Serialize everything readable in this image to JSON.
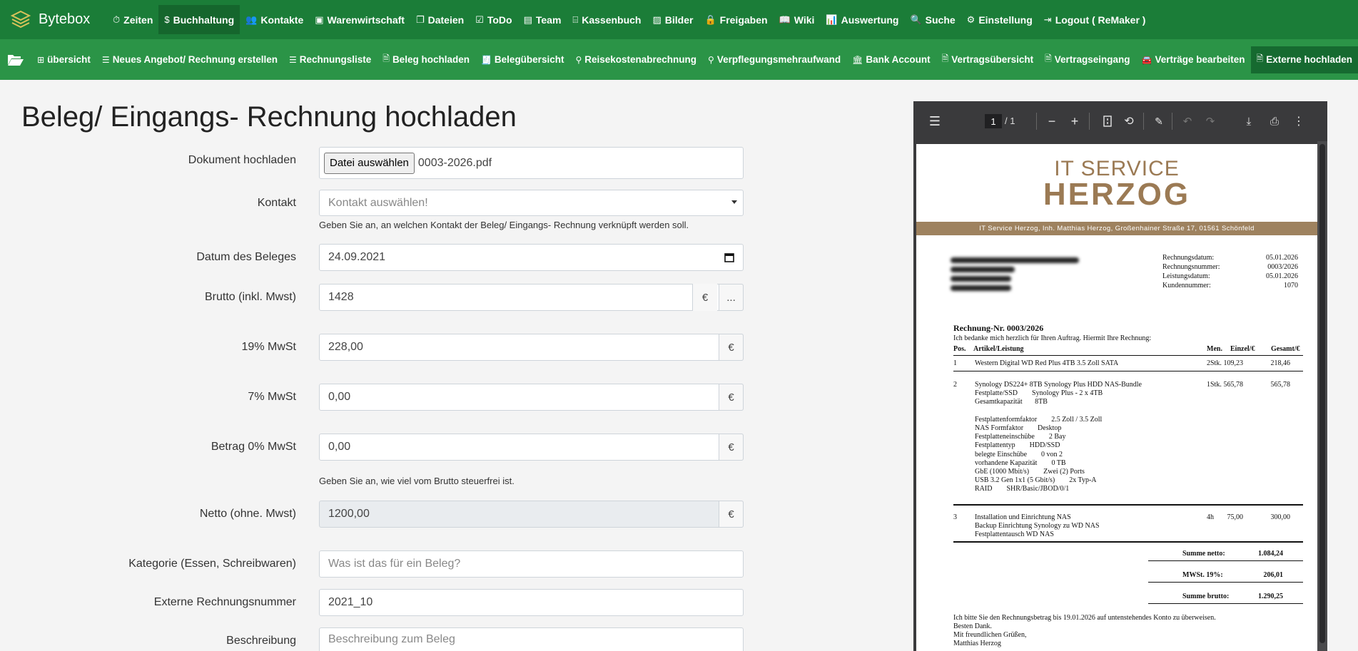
{
  "app": {
    "name": "Bytebox"
  },
  "topnav": [
    {
      "label": "Zeiten",
      "icon": "clock-icon",
      "glyph": "⏱",
      "active": false
    },
    {
      "label": "Buchhaltung",
      "icon": "invoice-icon",
      "glyph": "$",
      "active": true
    },
    {
      "label": "Kontakte",
      "icon": "users-icon",
      "glyph": "👥",
      "active": false
    },
    {
      "label": "Warenwirtschaft",
      "icon": "warehouse-icon",
      "glyph": "▣",
      "active": false
    },
    {
      "label": "Dateien",
      "icon": "files-icon",
      "glyph": "❐",
      "active": false
    },
    {
      "label": "ToDo",
      "icon": "clipboard-icon",
      "glyph": "☑",
      "active": false
    },
    {
      "label": "Team",
      "icon": "id-card-icon",
      "glyph": "▤",
      "active": false
    },
    {
      "label": "Kassenbuch",
      "icon": "cash-register-icon",
      "glyph": "⌸",
      "active": false
    },
    {
      "label": "Bilder",
      "icon": "image-icon",
      "glyph": "▨",
      "active": false
    },
    {
      "label": "Freigaben",
      "icon": "lock-icon",
      "glyph": "🔒",
      "active": false
    },
    {
      "label": "Wiki",
      "icon": "book-icon",
      "glyph": "📖",
      "active": false
    },
    {
      "label": "Auswertung",
      "icon": "chart-icon",
      "glyph": "📊",
      "active": false
    },
    {
      "label": "Suche",
      "icon": "search-icon",
      "glyph": "🔍",
      "active": false
    },
    {
      "label": "Einstellung",
      "icon": "gear-icon",
      "glyph": "⚙",
      "active": false
    },
    {
      "label": "Logout ( ReMaker )",
      "icon": "logout-icon",
      "glyph": "⇥",
      "active": false
    }
  ],
  "subnav": [
    {
      "label": "übersicht",
      "icon": "table-icon",
      "glyph": "⊞",
      "active": false
    },
    {
      "label": "Neues Angebot/ Rechnung erstellen",
      "icon": "list-icon",
      "glyph": "☰",
      "active": false
    },
    {
      "label": "Rechnungsliste",
      "icon": "list-icon",
      "glyph": "☰",
      "active": false
    },
    {
      "label": "Beleg hochladen",
      "icon": "file-upload-icon",
      "glyph": "🗎",
      "active": false
    },
    {
      "label": "Belegübersicht",
      "icon": "receipt-icon",
      "glyph": "🧾",
      "active": false
    },
    {
      "label": "Reisekostenabrechnung",
      "icon": "route-icon",
      "glyph": "⚲",
      "active": false
    },
    {
      "label": "Verpflegungsmehraufwand",
      "icon": "route-icon",
      "glyph": "⚲",
      "active": false
    },
    {
      "label": "Bank Account",
      "icon": "bank-icon",
      "glyph": "🏛",
      "active": false
    },
    {
      "label": "Vertragsübersicht",
      "icon": "document-icon",
      "glyph": "🗎",
      "active": false
    },
    {
      "label": "Vertragseingang",
      "icon": "document-icon",
      "glyph": "🗎",
      "active": false
    },
    {
      "label": "Verträge bearbeiten",
      "icon": "car-icon",
      "glyph": "🚘",
      "active": false
    },
    {
      "label": "Externe hochladen",
      "icon": "document-icon",
      "glyph": "🗎",
      "active": true
    }
  ],
  "page": {
    "title": "Beleg/ Eingangs- Rechnung hochladen"
  },
  "form": {
    "upload": {
      "label": "Dokument hochladen",
      "button": "Datei auswählen",
      "filename": "0003-2026.pdf"
    },
    "contact": {
      "label": "Kontakt",
      "placeholder": "Kontakt auswählen!",
      "hint": "Geben Sie an, an welchen Kontakt der Beleg/ Eingangs- Rechnung verknüpft werden soll."
    },
    "date": {
      "label": "Datum des Beleges",
      "value": "24.09.2021"
    },
    "gross": {
      "label": "Brutto (inkl. Mwst)",
      "value": "1428",
      "currency": "€",
      "more": "..."
    },
    "vat19": {
      "label": "19% MwSt",
      "value": "228,00",
      "currency": "€"
    },
    "vat7": {
      "label": "7% MwSt",
      "value": "0,00",
      "currency": "€"
    },
    "vat0": {
      "label": "Betrag 0% MwSt",
      "value": "0,00",
      "currency": "€",
      "hint": "Geben Sie an, wie viel vom Brutto steuerfrei ist."
    },
    "net": {
      "label": "Netto (ohne. Mwst)",
      "value": "1200,00",
      "currency": "€"
    },
    "category": {
      "label": "Kategorie (Essen, Schreibwaren)",
      "placeholder": "Was ist das für ein Beleg?"
    },
    "extnum": {
      "label": "Externe Rechnungsnummer",
      "value": "2021_10"
    },
    "description": {
      "label": "Beschreibung",
      "placeholder": "Beschreibung zum Beleg"
    }
  },
  "viewer": {
    "page_current": "1",
    "page_total": "/ 1"
  },
  "pdf": {
    "logo_top": "IT SERVICE",
    "logo_main": "HERZOG",
    "band": "IT Service Herzog, Inh. Matthias Herzog, Großenhainer Straße 17, 01561 Schönfeld",
    "meta": [
      {
        "label": "Rechnungsdatum:",
        "value": "05.01.2026"
      },
      {
        "label": "Rechnungsnummer:",
        "value": "0003/2026"
      },
      {
        "label": "Leistungsdatum:",
        "value": "05.01.2026"
      },
      {
        "label": "Kundennummer:",
        "value": "1070"
      }
    ],
    "title": "Rechnung-Nr. 0003/2026",
    "intro": "Ich bedanke mich herzlich für Ihren Auftrag. Hiermit Ihre Rechnung:",
    "headers": {
      "pos": "Pos.",
      "article": "Artikel/Leistung",
      "qty": "Men.",
      "unit": "Einzel/€",
      "total": "Gesamt/€"
    },
    "item1": {
      "pos": "1",
      "text": "Western Digital WD Red Plus 4TB 3.5 Zoll SATA",
      "qty": "2Stk.",
      "unit": "109,23",
      "total": "218,46"
    },
    "item2": {
      "pos": "2",
      "qty": "1Stk.",
      "unit": "565,78",
      "total": "565,78",
      "lines": [
        "Synology DS224+ 8TB Synology Plus HDD NAS-Bundle",
        "Festplatte/SSD        Synology Plus - 2 x 4TB",
        "Gesamtkapazität       8TB",
        "",
        "Festplattenformfaktor        2.5 Zoll / 3.5 Zoll",
        "NAS Formfaktor        Desktop",
        "Festplatteneinschübe        2 Bay",
        "Festplattentyp        HDD/SSD",
        "belegte Einschübe        0 von 2",
        "vorhandene Kapazität        0 TB",
        "GbE (1000 Mbit/s)        Zwei (2) Ports",
        "USB 3.2 Gen 1x1 (5 Gbit/s)        2x Typ-A",
        "RAID        SHR/Basic/JBOD/0/1"
      ]
    },
    "item3": {
      "pos": "3",
      "qty": "4h",
      "unit": "75,00",
      "total": "300,00",
      "lines": [
        "Installation und Einrichtung NAS",
        "Backup Einrichtung Synology zu WD NAS",
        "Festplattentausch WD NAS"
      ]
    },
    "sums": [
      {
        "label": "Summe netto:",
        "value": "1.084,24"
      },
      {
        "label": "MWSt. 19%:",
        "value": "206,01"
      },
      {
        "label": "Summe brutto:",
        "value": "1.290,25"
      }
    ],
    "footer": [
      "Ich bitte Sie den Rechnungsbetrag bis 19.01.2026 auf untenstehendes Konto zu überweisen.",
      "Besten Dank.",
      "Mit freundlichen Grüßen,",
      "Matthias Herzog"
    ]
  }
}
